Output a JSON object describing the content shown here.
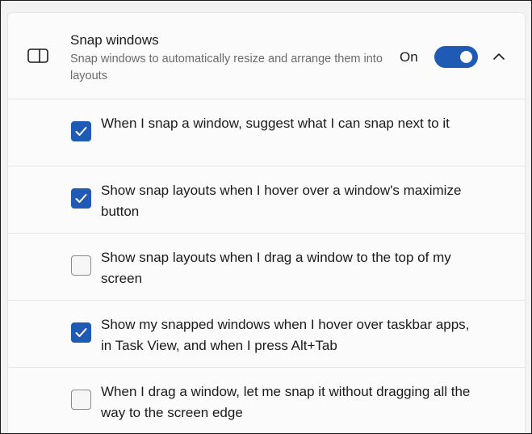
{
  "snap": {
    "title": "Snap windows",
    "description": "Snap windows to automatically resize and arrange them into layouts",
    "toggle_label": "On",
    "toggle_on": true,
    "icon": "snap-windows-icon",
    "chevron_icon": "chevron-up-icon"
  },
  "options": [
    {
      "label": "When I snap a window, suggest what I can snap next to it",
      "checked": true
    },
    {
      "label": "Show snap layouts when I hover over a window's maximize button",
      "checked": true
    },
    {
      "label": "Show snap layouts when I drag a window to the top of my screen",
      "checked": false
    },
    {
      "label": "Show my snapped windows when I hover over taskbar apps, in Task View, and when I press Alt+Tab",
      "checked": true
    },
    {
      "label": "When I drag a window, let me snap it without dragging all the way to the screen edge",
      "checked": false
    }
  ],
  "colors": {
    "accent": "#1f5bb4",
    "card_background": "#fbfbfb",
    "page_background": "#f3f3f3"
  }
}
